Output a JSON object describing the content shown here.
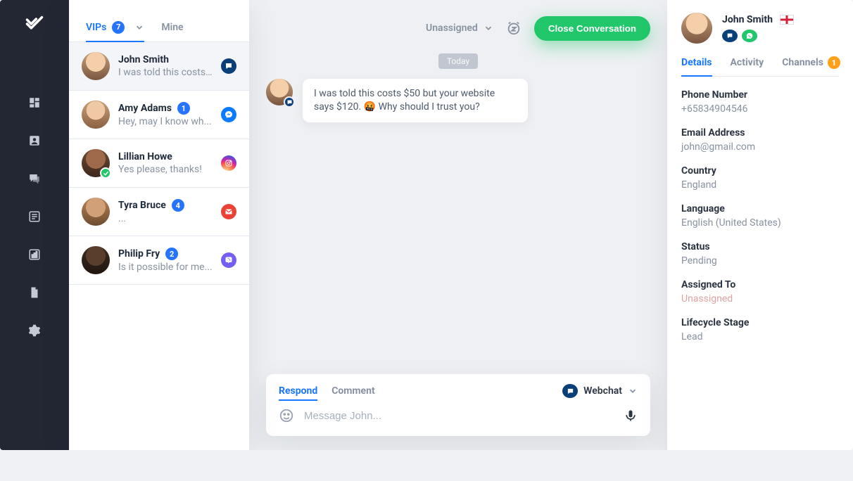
{
  "tabs": {
    "vips_label": "VIPs",
    "vips_count": "7",
    "mine_label": "Mine"
  },
  "conversations": [
    {
      "name": "John Smith",
      "preview": "I was told this costs...",
      "source_label": "Webchat"
    },
    {
      "name": "Amy Adams",
      "preview": "Hey, may I know wh...",
      "badge": "1",
      "source_label": "Messenger"
    },
    {
      "name": "Lillian Howe",
      "preview": "Yes please, thanks!",
      "source_label": "Instagram"
    },
    {
      "name": "Tyra Bruce",
      "preview": "...",
      "badge": "4",
      "source_label": "Gmail"
    },
    {
      "name": "Philip Fry",
      "preview": "Is it possible for me...",
      "badge": "2",
      "source_label": "Viber"
    }
  ],
  "conversation": {
    "assignee": "Unassigned",
    "close_label": "Close Conversation",
    "day_label": "Today",
    "message": "I was told this costs $50 but your website says $120. 🤬 Why should I trust you?"
  },
  "composer": {
    "respond_label": "Respond",
    "comment_label": "Comment",
    "channel_label": "Webchat",
    "placeholder": "Message John..."
  },
  "profile": {
    "name": "John Smith",
    "tabs": {
      "details": "Details",
      "activity": "Activity",
      "channels": "Channels",
      "channels_badge": "1"
    },
    "fields": {
      "phone_label": "Phone Number",
      "phone_value": "+65834904546",
      "email_label": "Email Address",
      "email_value": "john@gmail.com",
      "country_label": "Country",
      "country_value": "England",
      "language_label": "Language",
      "language_value": "English (United States)",
      "status_label": "Status",
      "status_value": "Pending",
      "assigned_label": "Assigned To",
      "assigned_value": "Unassigned",
      "stage_label": "Lifecycle Stage",
      "stage_value": "Lead"
    }
  }
}
